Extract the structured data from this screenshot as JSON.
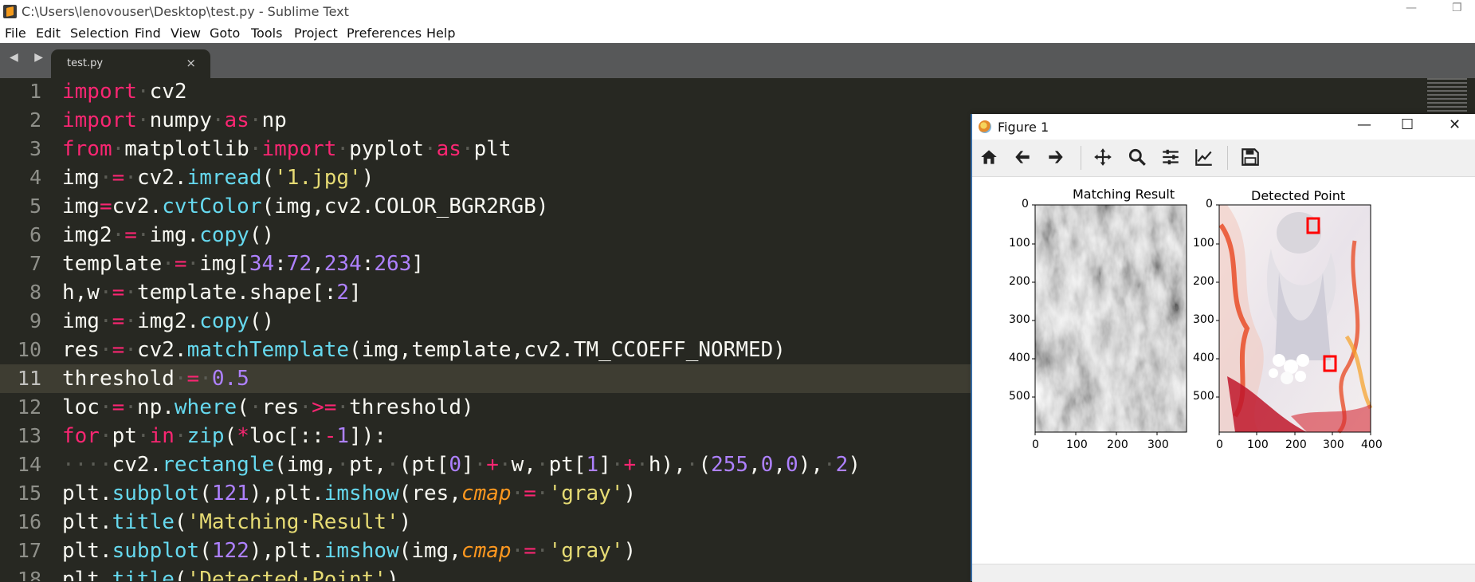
{
  "window": {
    "title": "C:\\Users\\lenovouser\\Desktop\\test.py - Sublime Text",
    "minimize_glyph": "—",
    "restore_glyph": "❐"
  },
  "menu": [
    "File",
    "Edit",
    "Selection",
    "Find",
    "View",
    "Goto",
    "Tools",
    "Project",
    "Preferences",
    "Help"
  ],
  "tabs": {
    "nav": "◀ ▶",
    "active": {
      "label": "test.py",
      "close": "×"
    }
  },
  "editor": {
    "active_line": 11,
    "lines": [
      [
        [
          "kw",
          "import"
        ],
        [
          "ws",
          "·"
        ],
        [
          "n",
          "cv2"
        ]
      ],
      [
        [
          "kw",
          "import"
        ],
        [
          "ws",
          "·"
        ],
        [
          "n",
          "numpy"
        ],
        [
          "ws",
          "·"
        ],
        [
          "kw",
          "as"
        ],
        [
          "ws",
          "·"
        ],
        [
          "n",
          "np"
        ]
      ],
      [
        [
          "kw",
          "from"
        ],
        [
          "ws",
          "·"
        ],
        [
          "n",
          "matplotlib"
        ],
        [
          "ws",
          "·"
        ],
        [
          "kw",
          "import"
        ],
        [
          "ws",
          "·"
        ],
        [
          "n",
          "pyplot"
        ],
        [
          "ws",
          "·"
        ],
        [
          "kw",
          "as"
        ],
        [
          "ws",
          "·"
        ],
        [
          "n",
          "plt"
        ]
      ],
      [
        [
          "n",
          "img"
        ],
        [
          "ws",
          "·"
        ],
        [
          "kw",
          "="
        ],
        [
          "ws",
          "·"
        ],
        [
          "n",
          "cv2."
        ],
        [
          "fn",
          "imread"
        ],
        [
          "n",
          "("
        ],
        [
          "str",
          "'1.jpg'"
        ],
        [
          "n",
          ")"
        ]
      ],
      [
        [
          "n",
          "img"
        ],
        [
          "kw",
          "="
        ],
        [
          "n",
          "cv2."
        ],
        [
          "fn",
          "cvtColor"
        ],
        [
          "n",
          "(img,cv2.COLOR_BGR2RGB)"
        ]
      ],
      [
        [
          "n",
          "img2"
        ],
        [
          "ws",
          "·"
        ],
        [
          "kw",
          "="
        ],
        [
          "ws",
          "·"
        ],
        [
          "n",
          "img."
        ],
        [
          "fn",
          "copy"
        ],
        [
          "n",
          "()"
        ]
      ],
      [
        [
          "n",
          "template"
        ],
        [
          "ws",
          "·"
        ],
        [
          "kw",
          "="
        ],
        [
          "ws",
          "·"
        ],
        [
          "n",
          "img["
        ],
        [
          "num",
          "34"
        ],
        [
          "n",
          ":"
        ],
        [
          "num",
          "72"
        ],
        [
          "n",
          ","
        ],
        [
          "num",
          "234"
        ],
        [
          "n",
          ":"
        ],
        [
          "num",
          "263"
        ],
        [
          "n",
          "]"
        ]
      ],
      [
        [
          "n",
          "h,w"
        ],
        [
          "ws",
          "·"
        ],
        [
          "kw",
          "="
        ],
        [
          "ws",
          "·"
        ],
        [
          "n",
          "template.shape[:"
        ],
        [
          "num",
          "2"
        ],
        [
          "n",
          "]"
        ]
      ],
      [
        [
          "n",
          "img"
        ],
        [
          "ws",
          "·"
        ],
        [
          "kw",
          "="
        ],
        [
          "ws",
          "·"
        ],
        [
          "n",
          "img2."
        ],
        [
          "fn",
          "copy"
        ],
        [
          "n",
          "()"
        ]
      ],
      [
        [
          "n",
          "res"
        ],
        [
          "ws",
          "·"
        ],
        [
          "kw",
          "="
        ],
        [
          "ws",
          "·"
        ],
        [
          "n",
          "cv2."
        ],
        [
          "fn",
          "matchTemplate"
        ],
        [
          "n",
          "(img,template,cv2.TM_CCOEFF_NORMED)"
        ]
      ],
      [
        [
          "n",
          "threshold"
        ],
        [
          "ws",
          "·"
        ],
        [
          "kw",
          "="
        ],
        [
          "ws",
          "·"
        ],
        [
          "num",
          "0.5"
        ]
      ],
      [
        [
          "n",
          "loc"
        ],
        [
          "ws",
          "·"
        ],
        [
          "kw",
          "="
        ],
        [
          "ws",
          "·"
        ],
        [
          "n",
          "np."
        ],
        [
          "fn",
          "where"
        ],
        [
          "n",
          "("
        ],
        [
          "ws",
          "·"
        ],
        [
          "n",
          "res"
        ],
        [
          "ws",
          "·"
        ],
        [
          "kw",
          ">="
        ],
        [
          "ws",
          "·"
        ],
        [
          "n",
          "threshold)"
        ]
      ],
      [
        [
          "kw",
          "for"
        ],
        [
          "ws",
          "·"
        ],
        [
          "n",
          "pt"
        ],
        [
          "ws",
          "·"
        ],
        [
          "kw",
          "in"
        ],
        [
          "ws",
          "·"
        ],
        [
          "fn",
          "zip"
        ],
        [
          "n",
          "("
        ],
        [
          "kw",
          "*"
        ],
        [
          "n",
          "loc[::"
        ],
        [
          "kw",
          "-"
        ],
        [
          "num",
          "1"
        ],
        [
          "n",
          "]):"
        ]
      ],
      [
        [
          "ws",
          "····"
        ],
        [
          "n",
          "cv2."
        ],
        [
          "fn",
          "rectangle"
        ],
        [
          "n",
          "(img,"
        ],
        [
          "ws",
          "·"
        ],
        [
          "n",
          "pt,"
        ],
        [
          "ws",
          "·"
        ],
        [
          "n",
          "(pt["
        ],
        [
          "num",
          "0"
        ],
        [
          "n",
          "]"
        ],
        [
          "ws",
          "·"
        ],
        [
          "kw",
          "+"
        ],
        [
          "ws",
          "·"
        ],
        [
          "n",
          "w,"
        ],
        [
          "ws",
          "·"
        ],
        [
          "n",
          "pt["
        ],
        [
          "num",
          "1"
        ],
        [
          "n",
          "]"
        ],
        [
          "ws",
          "·"
        ],
        [
          "kw",
          "+"
        ],
        [
          "ws",
          "·"
        ],
        [
          "n",
          "h),"
        ],
        [
          "ws",
          "·"
        ],
        [
          "n",
          "("
        ],
        [
          "num",
          "255"
        ],
        [
          "n",
          ","
        ],
        [
          "num",
          "0"
        ],
        [
          "n",
          ","
        ],
        [
          "num",
          "0"
        ],
        [
          "n",
          "),"
        ],
        [
          "ws",
          "·"
        ],
        [
          "num",
          "2"
        ],
        [
          "n",
          ")"
        ]
      ],
      [
        [
          "n",
          "plt."
        ],
        [
          "fn",
          "subplot"
        ],
        [
          "n",
          "("
        ],
        [
          "num",
          "121"
        ],
        [
          "n",
          "),plt."
        ],
        [
          "fn",
          "imshow"
        ],
        [
          "n",
          "(res,"
        ],
        [
          "arg",
          "cmap"
        ],
        [
          "ws",
          "·"
        ],
        [
          "kw",
          "="
        ],
        [
          "ws",
          "·"
        ],
        [
          "str",
          "'gray'"
        ],
        [
          "n",
          ")"
        ]
      ],
      [
        [
          "n",
          "plt."
        ],
        [
          "fn",
          "title"
        ],
        [
          "n",
          "("
        ],
        [
          "str",
          "'Matching·Result'"
        ],
        [
          "n",
          ")"
        ]
      ],
      [
        [
          "n",
          "plt."
        ],
        [
          "fn",
          "subplot"
        ],
        [
          "n",
          "("
        ],
        [
          "num",
          "122"
        ],
        [
          "n",
          "),plt."
        ],
        [
          "fn",
          "imshow"
        ],
        [
          "n",
          "(img,"
        ],
        [
          "arg",
          "cmap"
        ],
        [
          "ws",
          "·"
        ],
        [
          "kw",
          "="
        ],
        [
          "ws",
          "·"
        ],
        [
          "str",
          "'gray'"
        ],
        [
          "n",
          ")"
        ]
      ],
      [
        [
          "n",
          "plt."
        ],
        [
          "fn",
          "title"
        ],
        [
          "n",
          "("
        ],
        [
          "str",
          "'Detected·Point'"
        ],
        [
          "n",
          ")"
        ]
      ]
    ]
  },
  "syntax_colors": {
    "kw": "#f92672",
    "fn": "#66d9ef",
    "str": "#e6db74",
    "num": "#ae81ff",
    "arg": "#fd971f",
    "n": "#f8f8f2",
    "ws": "#5b5c55"
  },
  "figure": {
    "title": "Figure 1",
    "controls": {
      "minimize": "—",
      "maximize": "☐",
      "close": "✕"
    },
    "toolbar": [
      "home-icon",
      "back-icon",
      "forward-icon",
      "pan-icon",
      "zoom-icon",
      "configure-subplots-icon",
      "edit-axis-icon",
      "save-icon"
    ],
    "plots": [
      {
        "title": "Matching Result",
        "x_ticks": [
          "0",
          "100",
          "200",
          "300"
        ],
        "y_ticks": [
          "0",
          "100",
          "200",
          "300",
          "400",
          "500"
        ],
        "cmap": "gray"
      },
      {
        "title": "Detected Point",
        "x_ticks": [
          "0",
          "100",
          "200",
          "300",
          "400"
        ],
        "y_ticks": [
          "0",
          "100",
          "200",
          "300",
          "400",
          "500"
        ],
        "markers": "red rectangles"
      }
    ]
  }
}
